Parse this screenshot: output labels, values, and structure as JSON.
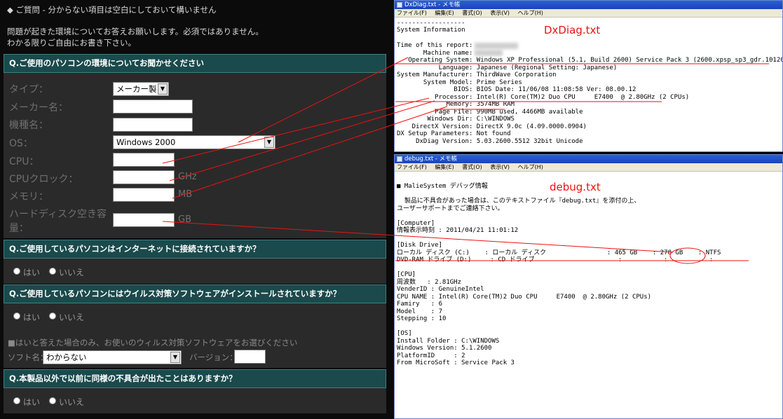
{
  "form": {
    "heading": "◆ ご質問 - 分からない項目は空白にしておいて構いません",
    "intro_line1": "問題が起きた環境についてお答えお願いします。必須ではありません。",
    "intro_line2": "わかる限りご自由にお書き下さい。",
    "q1": {
      "title": "Q.ご使用のパソコンの環境についてお聞かせください",
      "type_label": "タイプ：",
      "type_value": "メーカー製",
      "maker_label": "メーカー名：",
      "model_label": "機種名：",
      "os_label": "OS：",
      "os_value": "Windows 2000",
      "cpu_label": "CPU：",
      "clock_label": "CPUクロック：",
      "clock_unit": "GHz",
      "memory_label": "メモリ：",
      "memory_unit": "MB",
      "hdd_label_line1": "ハードディスク空き容",
      "hdd_label_line2": "量：",
      "hdd_unit": "GB"
    },
    "q2": {
      "title": "Q.ご使用しているパソコンはインターネットに接続されていますか？",
      "yes": "はい",
      "no": "いいえ"
    },
    "q3": {
      "title": "Q.ご使用しているパソコンにはウイルス対策ソフトウェアがインストールされていますか？",
      "yes": "はい",
      "no": "いいえ",
      "note": "■はいと答えた場合のみ、お使いのウィルス対策ソフトウェアをお選びください",
      "software_label": "ソフト名：",
      "software_value": "わからない",
      "version_label": "バージョン："
    },
    "q4": {
      "title": "Q.本製品以外で以前に同様の不具合が出たことはありますか？",
      "yes": "はい",
      "no": "いいえ"
    }
  },
  "dxdiag": {
    "window_title": "DxDiag.txt - メモ帳",
    "label": "DxDiag.txt",
    "menu": [
      "ファイル(F)",
      "編集(E)",
      "書式(O)",
      "表示(V)",
      "ヘルプ(H)"
    ],
    "separator": "------------------",
    "section": "System Information",
    "lines": [
      "Time of this report:",
      "       Machine name:",
      "   Operating System: Windows XP Professional (5.1, Build 2600) Service Pack 3 (2600.xpsp_sp3_gdr.101209-1647)",
      "           Language: Japanese (Regional Setting: Japanese)",
      "System Manufacturer: ThirdWave Corporation",
      "       System Model: Prime Series",
      "               BIOS: BIOS Date: 11/06/08 11:08:58 Ver: 08.00.12",
      "          Processor: Intel(R) Core(TM)2 Duo CPU     E7400  @ 2.80GHz (2 CPUs)",
      "             Memory: 3574MB RAM",
      "          Page File: 990MB used, 4466MB available",
      "        Windows Dir: C:\\WINDOWS",
      "    DirectX Version: DirectX 9.0c (4.09.0000.0904)",
      "DX Setup Parameters: Not found",
      "     DxDiag Version: 5.03.2600.5512 32bit Unicode"
    ]
  },
  "debug": {
    "window_title": "debug.txt - メモ帳",
    "label": "debug.txt",
    "menu": [
      "ファイル(F)",
      "編集(E)",
      "書式(O)",
      "表示(V)",
      "ヘルプ(H)"
    ],
    "lines": [
      "■ MalieSystem デバッグ情報",
      "",
      "  製品に不具合があった場合は、このテキストファイル『debug.txt』を添付の上、",
      "ユーザーサポートまでご連絡下さい。",
      "",
      "[Computer]",
      "情報表示時刻 : 2011/04/21 11:01:12",
      "",
      "[Disk Drive]",
      "ローカル ディスク (C:)    : ローカル ディスク                : 465 GB    : 278 GB    : NTFS",
      "DVD-RAM ドライブ (D:)     : CD ドライブ                      :           :           :",
      "",
      "[CPU]",
      "周波数   : 2.81GHz",
      "VenderID : GenuineIntel",
      "CPU NAME : Intel(R) Core(TM)2 Duo CPU     E7400  @ 2.80GHz (2 CPUs)",
      "Famiry   : 6",
      "Model    : 7",
      "Stepping : 10",
      "",
      "[OS]",
      "Install Folder : C:\\WINDOWS",
      "Windows Version: 5.1.2600",
      "PlatformID     : 2",
      "From MicroSoft : Service Pack 3"
    ]
  },
  "colors": {
    "annotation": "#ee1111",
    "header_bg": "#1a4a4c",
    "panel_bg": "#2a2a2a"
  }
}
